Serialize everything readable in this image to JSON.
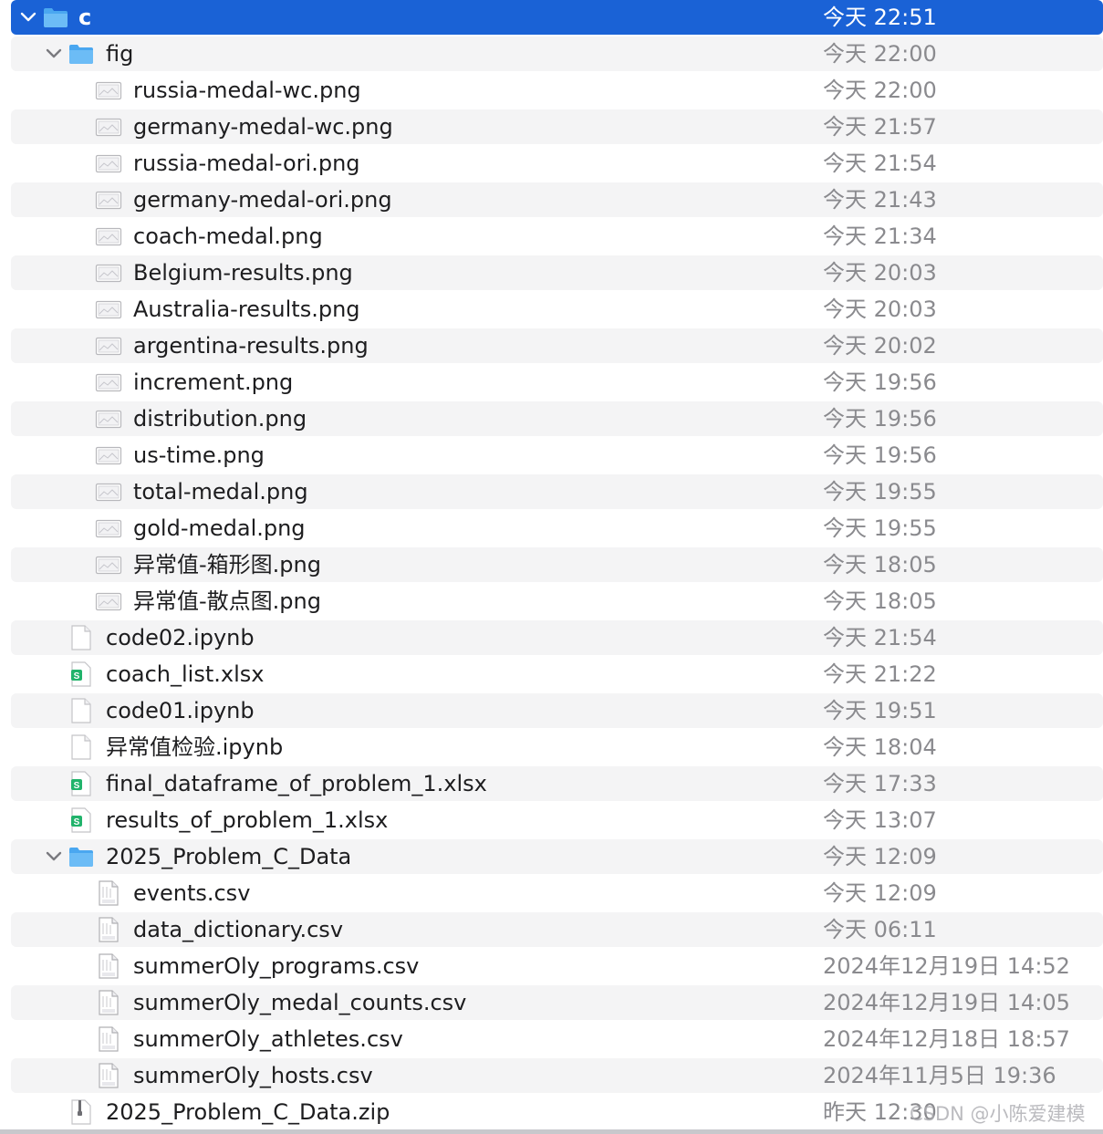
{
  "colors": {
    "selection": "#1a62d6",
    "stripe": "#f4f4f5",
    "date_text": "#8a8a8e",
    "folder": "#4aa7f0",
    "sheet_badge": "#21b36b"
  },
  "rows": [
    {
      "name": "c",
      "date": "今天 22:51",
      "icon": "folder-icon",
      "depth": 0,
      "expanded": true,
      "selected": true
    },
    {
      "name": "fig",
      "date": "今天 22:00",
      "icon": "folder-icon",
      "depth": 1,
      "expanded": true
    },
    {
      "name": "russia-medal-wc.png",
      "date": "今天 22:00",
      "icon": "image-icon",
      "depth": 2
    },
    {
      "name": "germany-medal-wc.png",
      "date": "今天 21:57",
      "icon": "image-icon",
      "depth": 2
    },
    {
      "name": "russia-medal-ori.png",
      "date": "今天 21:54",
      "icon": "image-icon",
      "depth": 2
    },
    {
      "name": "germany-medal-ori.png",
      "date": "今天 21:43",
      "icon": "image-icon",
      "depth": 2
    },
    {
      "name": "coach-medal.png",
      "date": "今天 21:34",
      "icon": "image-icon",
      "depth": 2
    },
    {
      "name": "Belgium-results.png",
      "date": "今天 20:03",
      "icon": "image-icon",
      "depth": 2
    },
    {
      "name": "Australia-results.png",
      "date": "今天 20:03",
      "icon": "image-icon",
      "depth": 2
    },
    {
      "name": "argentina-results.png",
      "date": "今天 20:02",
      "icon": "image-icon",
      "depth": 2
    },
    {
      "name": "increment.png",
      "date": "今天 19:56",
      "icon": "image-icon",
      "depth": 2
    },
    {
      "name": "distribution.png",
      "date": "今天 19:56",
      "icon": "image-icon",
      "depth": 2
    },
    {
      "name": "us-time.png",
      "date": "今天 19:56",
      "icon": "image-icon",
      "depth": 2
    },
    {
      "name": "total-medal.png",
      "date": "今天 19:55",
      "icon": "image-icon",
      "depth": 2
    },
    {
      "name": "gold-medal.png",
      "date": "今天 19:55",
      "icon": "image-icon",
      "depth": 2
    },
    {
      "name": "异常值-箱形图.png",
      "date": "今天 18:05",
      "icon": "image-icon",
      "depth": 2
    },
    {
      "name": "异常值-散点图.png",
      "date": "今天 18:05",
      "icon": "image-icon",
      "depth": 2
    },
    {
      "name": "code02.ipynb",
      "date": "今天 21:54",
      "icon": "document-icon",
      "depth": 1
    },
    {
      "name": "coach_list.xlsx",
      "date": "今天 21:22",
      "icon": "spreadsheet-icon",
      "depth": 1
    },
    {
      "name": "code01.ipynb",
      "date": "今天 19:51",
      "icon": "document-icon",
      "depth": 1
    },
    {
      "name": "异常值检验.ipynb",
      "date": "今天 18:04",
      "icon": "document-icon",
      "depth": 1
    },
    {
      "name": "final_dataframe_of_problem_1.xlsx",
      "date": "今天 17:33",
      "icon": "spreadsheet-icon",
      "depth": 1
    },
    {
      "name": "results_of_problem_1.xlsx",
      "date": "今天 13:07",
      "icon": "spreadsheet-icon",
      "depth": 1
    },
    {
      "name": "2025_Problem_C_Data",
      "date": "今天 12:09",
      "icon": "folder-icon",
      "depth": 1,
      "expanded": true
    },
    {
      "name": "events.csv",
      "date": "今天 12:09",
      "icon": "csv-icon",
      "depth": 2
    },
    {
      "name": "data_dictionary.csv",
      "date": "今天 06:11",
      "icon": "csv-icon",
      "depth": 2
    },
    {
      "name": "summerOly_programs.csv",
      "date": "2024年12月19日 14:52",
      "icon": "csv-icon",
      "depth": 2
    },
    {
      "name": "summerOly_medal_counts.csv",
      "date": "2024年12月19日 14:05",
      "icon": "csv-icon",
      "depth": 2
    },
    {
      "name": "summerOly_athletes.csv",
      "date": "2024年12月18日 18:57",
      "icon": "csv-icon",
      "depth": 2
    },
    {
      "name": "summerOly_hosts.csv",
      "date": "2024年11月5日 19:36",
      "icon": "csv-icon",
      "depth": 2
    },
    {
      "name": "2025_Problem_C_Data.zip",
      "date": "昨天 12:30",
      "icon": "zip-icon",
      "depth": 1
    }
  ],
  "watermark": "CSDN @小陈爱建模"
}
